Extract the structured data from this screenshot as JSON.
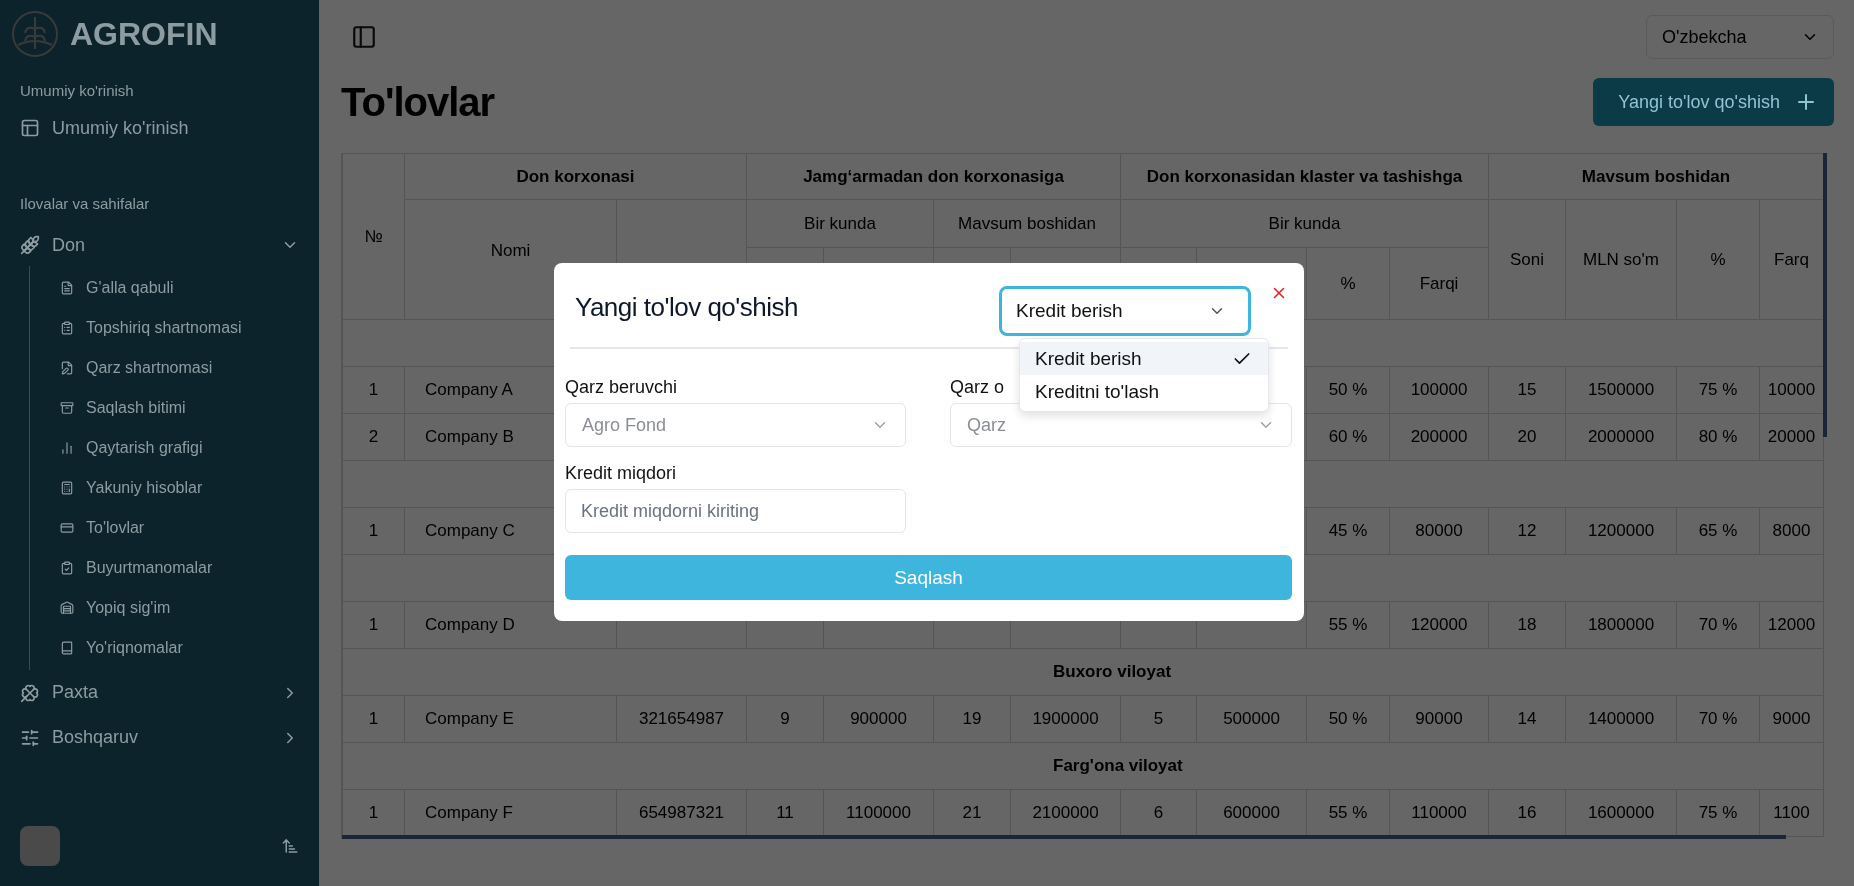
{
  "sidebar": {
    "brand": "AGROFIN",
    "overview_label": "Umumiy ko'rinish",
    "overview_item": "Umumiy ko'rinish",
    "apps_label": "Ilovalar va sahifalar",
    "groups": [
      {
        "label": "Don",
        "expanded": true,
        "children": [
          {
            "label": "G'alla qabuli"
          },
          {
            "label": "Topshiriq shartnomasi"
          },
          {
            "label": "Qarz shartnomasi"
          },
          {
            "label": "Saqlash bitimi"
          },
          {
            "label": "Qaytarish grafigi"
          },
          {
            "label": "Yakuniy hisoblar"
          },
          {
            "label": "To'lovlar"
          },
          {
            "label": "Buyurtmanomalar"
          },
          {
            "label": "Yopiq sig'im"
          },
          {
            "label": "Yo'riqnomalar"
          }
        ]
      },
      {
        "label": "Paxta",
        "expanded": false
      },
      {
        "label": "Boshqaruv",
        "expanded": false
      }
    ]
  },
  "topbar": {
    "language": "O'zbekcha"
  },
  "page": {
    "title": "To'lovlar",
    "add_button": "Yangi to'lov qo'shish"
  },
  "table": {
    "columns": [
      {
        "label": "№"
      },
      {
        "label": "Don korxonasi",
        "children": [
          {
            "label": "Nomi"
          }
        ]
      },
      {
        "label": "Jamg‘armadan don korxonasiga",
        "children": [
          {
            "label": "Bir kunda"
          },
          {
            "label": "Mavsum boshidan"
          }
        ]
      },
      {
        "label": "Don korxonasidan klaster va tashishga",
        "children": [
          {
            "label": "Bir kunda",
            "children": [
              {
                "label": "%"
              },
              {
                "label": "Farqi"
              }
            ]
          }
        ]
      },
      {
        "label": "Mavsum boshidan",
        "children": [
          {
            "label": "Soni"
          },
          {
            "label": "MLN so'm"
          },
          {
            "label": "%"
          },
          {
            "label": "Farq"
          }
        ]
      }
    ],
    "rows": [
      {
        "kind": "region"
      },
      {
        "kind": "data",
        "cells": [
          "1",
          "Company A",
          null,
          null,
          null,
          null,
          null,
          null,
          null,
          "50 %",
          "100000",
          "15",
          "1500000",
          "75 %",
          "10000"
        ]
      },
      {
        "kind": "data",
        "cells": [
          "2",
          "Company B",
          null,
          null,
          null,
          null,
          null,
          null,
          null,
          "60 %",
          "200000",
          "20",
          "2000000",
          "80 %",
          "20000"
        ]
      },
      {
        "kind": "region"
      },
      {
        "kind": "data",
        "cells": [
          "1",
          "Company C",
          null,
          null,
          null,
          null,
          null,
          null,
          null,
          "45 %",
          "80000",
          "12",
          "1200000",
          "65 %",
          "8000"
        ]
      },
      {
        "kind": "region"
      },
      {
        "kind": "data",
        "cells": [
          "1",
          "Company D",
          null,
          null,
          null,
          null,
          null,
          null,
          null,
          "55 %",
          "120000",
          "18",
          "1800000",
          "70 %",
          "12000"
        ]
      },
      {
        "kind": "region",
        "label": "Buxoro viloyat"
      },
      {
        "kind": "data",
        "cells": [
          "1",
          "Company E",
          "321654987",
          "9",
          "900000",
          "19",
          "1900000",
          "5",
          "500000",
          "50 %",
          "90000",
          "14",
          "1400000",
          "70 %",
          "9000"
        ]
      },
      {
        "kind": "region",
        "label": "Farg'ona viloyat"
      },
      {
        "kind": "data",
        "cells": [
          "1",
          "Company F",
          "654987321",
          "11",
          "1100000",
          "21",
          "2100000",
          "6",
          "600000",
          "55 %",
          "110000",
          "16",
          "1600000",
          "75 %",
          "1100"
        ]
      }
    ]
  },
  "modal": {
    "title": "Yangi to'lov qo'shish",
    "type_select": {
      "value": "Kredit berish",
      "open": true,
      "options": [
        {
          "label": "Kredit berish",
          "selected": true
        },
        {
          "label": "Kreditni to'lash",
          "selected": false
        }
      ]
    },
    "fields": [
      {
        "kind": "select",
        "label": "Qarz beruvchi",
        "value": "Agro Fond",
        "disabled": true
      },
      {
        "kind": "select",
        "label": "Qarz o",
        "placeholder": "Qarz"
      },
      {
        "kind": "input",
        "label": "Kredit miqdori",
        "placeholder": "Kredit miqdorni kiriting"
      }
    ],
    "save_button": "Saqlash"
  }
}
